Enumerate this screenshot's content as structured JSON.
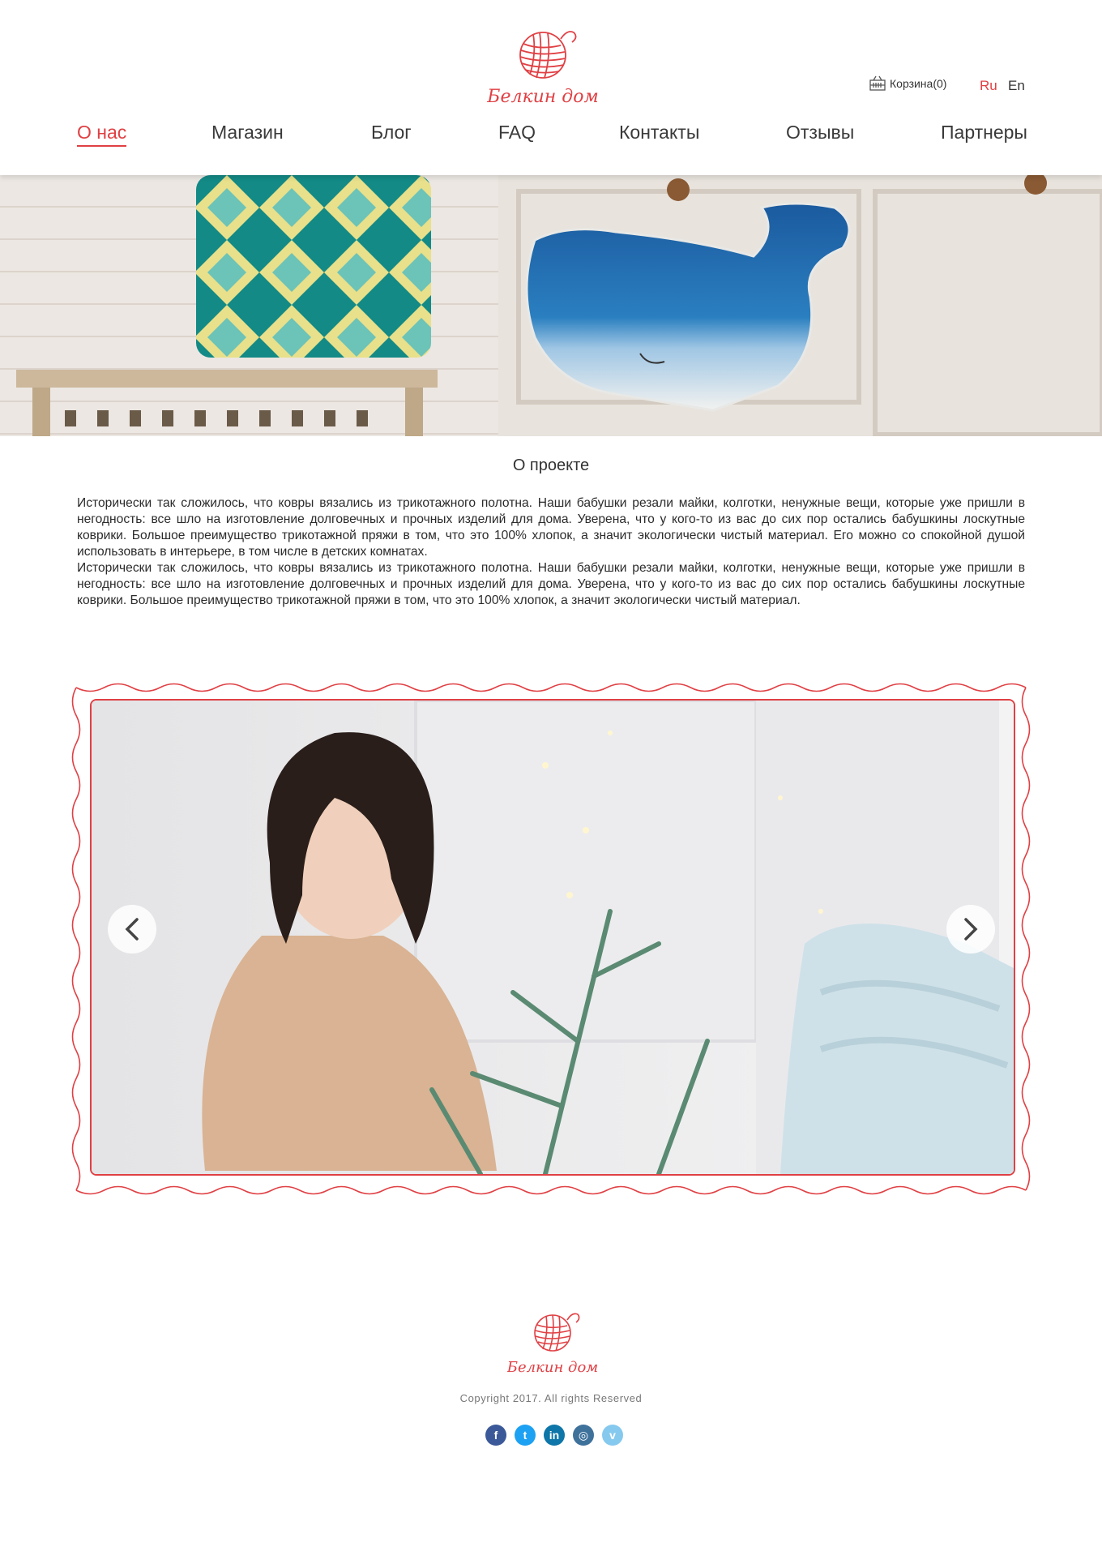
{
  "brand": {
    "name": "Белкин дом",
    "accent_color": "#e04044"
  },
  "header": {
    "cart_label": "Корзина(0)",
    "cart_icon": "shopping-basket-icon",
    "languages": [
      "Ru",
      "En"
    ],
    "active_language": "Ru"
  },
  "nav": {
    "items": [
      {
        "label": "О нас",
        "active": true
      },
      {
        "label": "Магазин",
        "active": false
      },
      {
        "label": "Блог",
        "active": false
      },
      {
        "label": "FAQ",
        "active": false
      },
      {
        "label": "Контакты",
        "active": false
      },
      {
        "label": "Отзывы",
        "active": false
      },
      {
        "label": "Партнеры",
        "active": false
      }
    ]
  },
  "about": {
    "title": "О проекте",
    "paragraphs": [
      "Исторически так сложилось, что ковры вязались из трикотажного полотна. Наши бабушки резали майки, колготки, ненужные вещи, которые уже пришли в негодность: все шло на изготовление долговечных и прочных изделий для дома. Уверена, что у кого-то из вас до сих пор остались бабушкины лоскутные коврики. Большое преимущество трикотажной пряжи в том, что это 100% хлопок, а значит экологически чистый материал. Его можно со спокойной душой использовать в интерьере, в том числе в детских комнатах.",
      "Исторически так сложилось, что ковры вязались из трикотажного полотна. Наши бабушки резали майки, колготки, ненужные вещи, которые уже пришли в негодность: все шло на изготовление долговечных и прочных изделий для дома. Уверена, что у кого-то из вас до сих пор остались бабушкины лоскутные коврики. Большое преимущество трикотажной пряжи в том, что это 100% хлопок, а значит экологически чистый материал."
    ]
  },
  "slider": {
    "prev_icon": "chevron-left-icon",
    "next_icon": "chevron-right-icon"
  },
  "footer": {
    "copyright": "Copyright 2017. All rights Reserved",
    "social": [
      {
        "name": "facebook-icon",
        "glyph": "f",
        "color": "#3b5998"
      },
      {
        "name": "twitter-icon",
        "glyph": "t",
        "color": "#1da1f2"
      },
      {
        "name": "linkedin-icon",
        "glyph": "in",
        "color": "#0e76a8"
      },
      {
        "name": "instagram-icon",
        "glyph": "◎",
        "color": "#3f729b"
      },
      {
        "name": "vimeo-icon",
        "glyph": "v",
        "color": "#86c9ef"
      }
    ]
  }
}
